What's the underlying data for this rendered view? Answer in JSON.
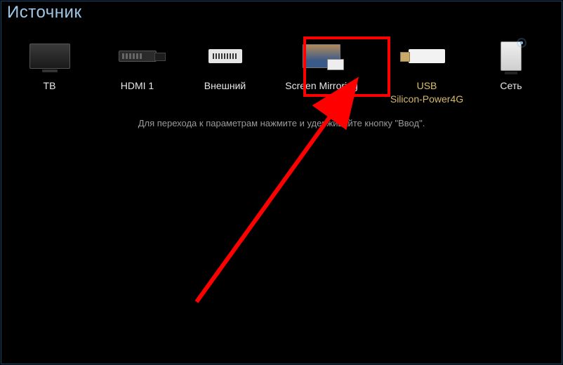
{
  "title": "Источник",
  "sources": [
    {
      "label": "ТВ",
      "sublabel": "",
      "icon": "tv-icon"
    },
    {
      "label": "HDMI 1",
      "sublabel": "",
      "icon": "hdmi-icon"
    },
    {
      "label": "Внешний",
      "sublabel": "",
      "icon": "external-port-icon"
    },
    {
      "label": "Screen Mirroring",
      "sublabel": "",
      "icon": "screen-mirroring-icon"
    },
    {
      "label": "USB",
      "sublabel": "Silicon-Power4G",
      "icon": "usb-drive-icon"
    },
    {
      "label": "Сеть",
      "sublabel": "",
      "icon": "network-icon"
    }
  ],
  "hint": "Для перехода к параметрам нажмите и удерживайте кнопку \"Ввод\".",
  "annotation": {
    "highlight_source_index": 3,
    "highlight_color": "#ff0000",
    "arrow_color": "#ff0000"
  }
}
